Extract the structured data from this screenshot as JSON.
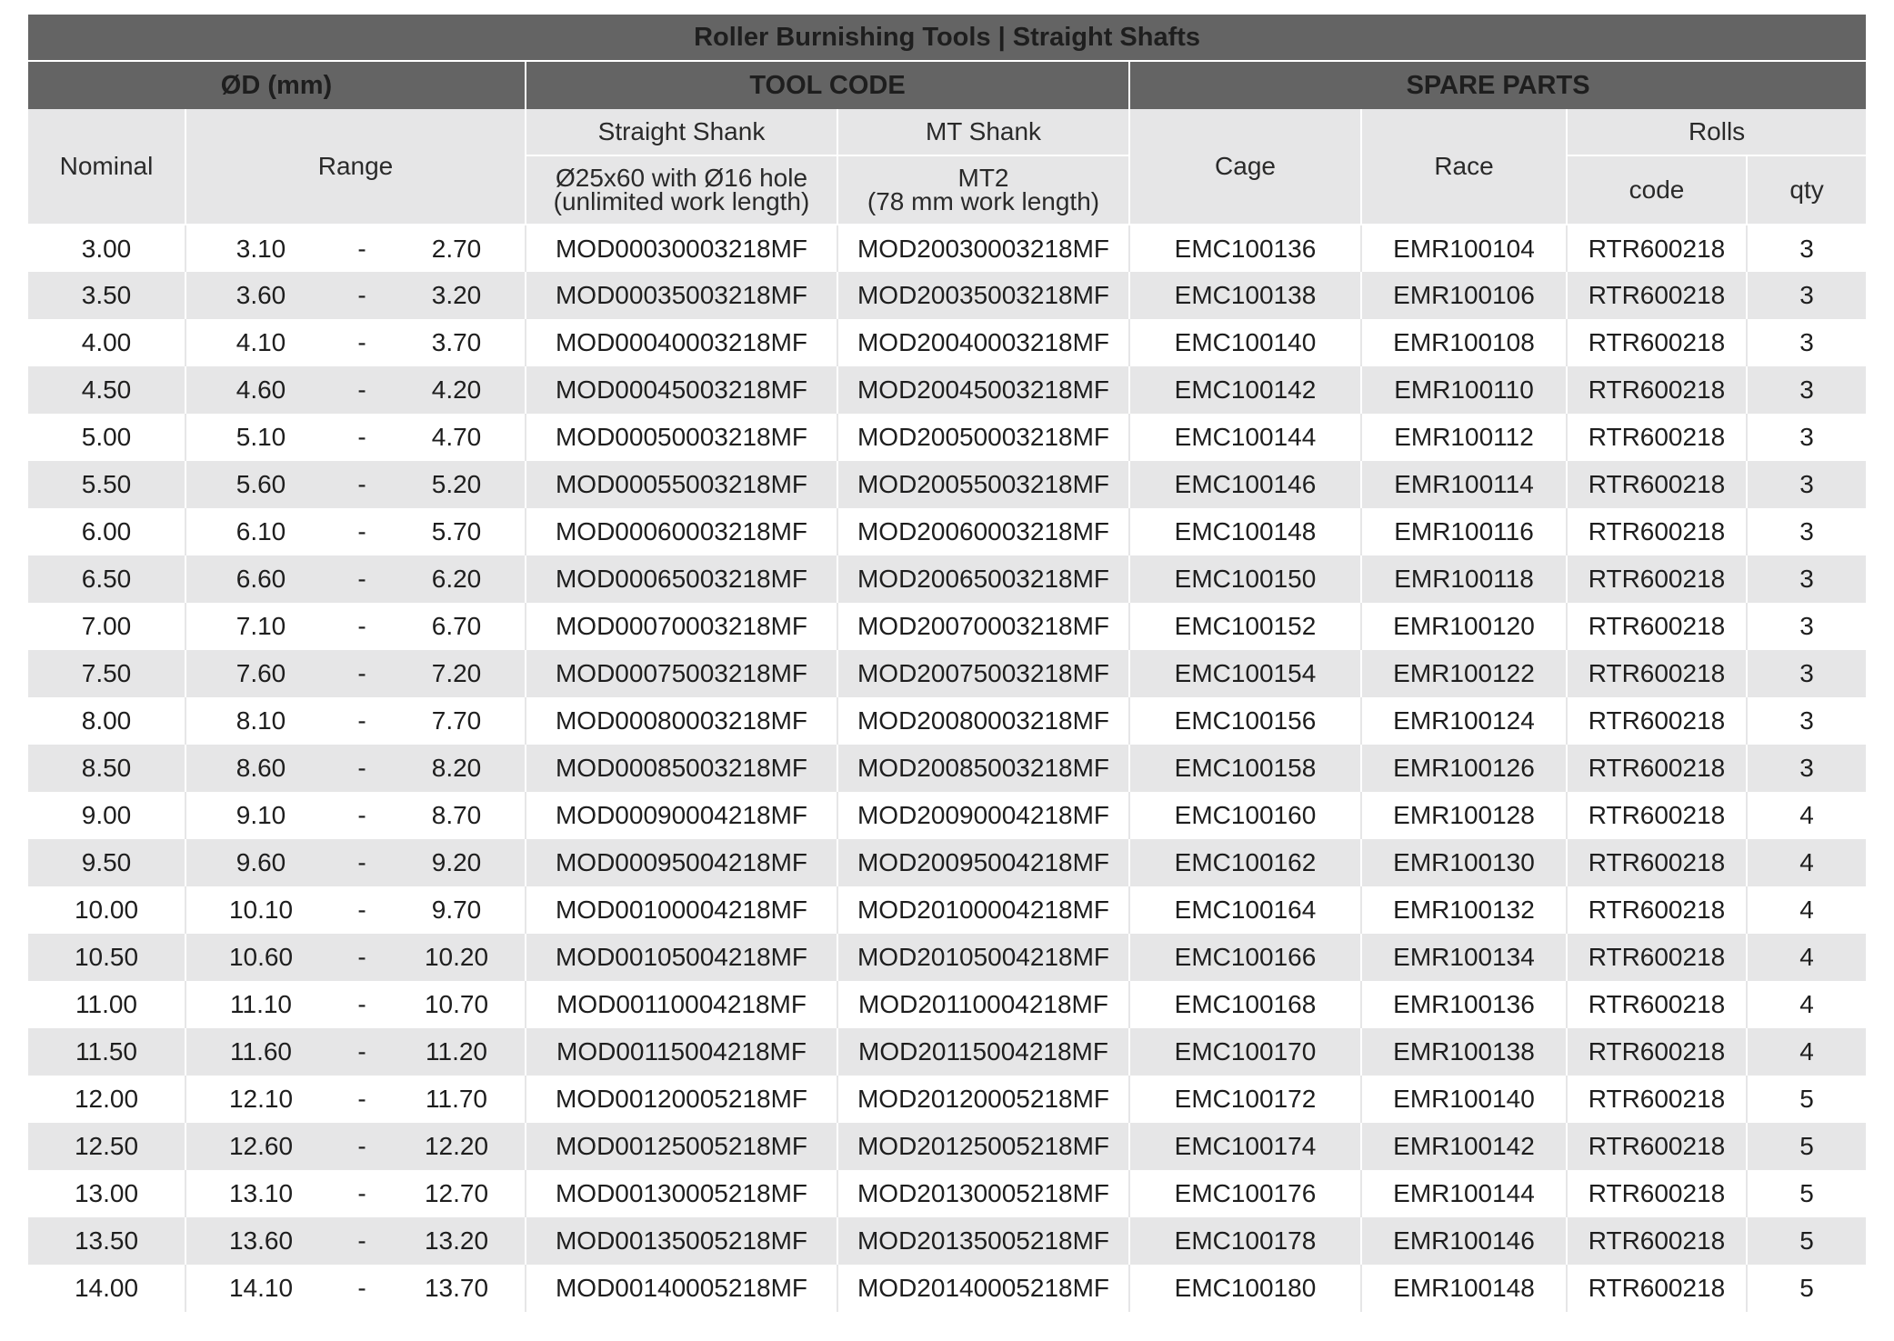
{
  "table": {
    "title": "Roller Burnishing Tools | Straight Shafts",
    "groups": {
      "od": "ØD (mm)",
      "tool_code": "TOOL CODE",
      "spare_parts": "SPARE PARTS"
    },
    "headers": {
      "nominal": "Nominal",
      "range": "Range",
      "straight_shank": "Straight Shank",
      "straight_shank_line1": "Ø25x60 with Ø16 hole",
      "straight_shank_line2": "(unlimited work length)",
      "mt_shank": "MT Shank",
      "mt_shank_line1": "MT2",
      "mt_shank_line2": "(78 mm work length)",
      "cage": "Cage",
      "race": "Race",
      "rolls": "Rolls",
      "rolls_code": "code",
      "rolls_qty": "qty"
    },
    "rows": [
      {
        "nominal": "3.00",
        "range_max": "3.10",
        "dash": "-",
        "range_min": "2.70",
        "straight_code": "MOD00030003218MF",
        "mt_code": "MOD20030003218MF",
        "cage": "EMC100136",
        "race": "EMR100104",
        "rolls_code": "RTR600218",
        "qty": "3"
      },
      {
        "nominal": "3.50",
        "range_max": "3.60",
        "dash": "-",
        "range_min": "3.20",
        "straight_code": "MOD00035003218MF",
        "mt_code": "MOD20035003218MF",
        "cage": "EMC100138",
        "race": "EMR100106",
        "rolls_code": "RTR600218",
        "qty": "3"
      },
      {
        "nominal": "4.00",
        "range_max": "4.10",
        "dash": "-",
        "range_min": "3.70",
        "straight_code": "MOD00040003218MF",
        "mt_code": "MOD20040003218MF",
        "cage": "EMC100140",
        "race": "EMR100108",
        "rolls_code": "RTR600218",
        "qty": "3"
      },
      {
        "nominal": "4.50",
        "range_max": "4.60",
        "dash": "-",
        "range_min": "4.20",
        "straight_code": "MOD00045003218MF",
        "mt_code": "MOD20045003218MF",
        "cage": "EMC100142",
        "race": "EMR100110",
        "rolls_code": "RTR600218",
        "qty": "3"
      },
      {
        "nominal": "5.00",
        "range_max": "5.10",
        "dash": "-",
        "range_min": "4.70",
        "straight_code": "MOD00050003218MF",
        "mt_code": "MOD20050003218MF",
        "cage": "EMC100144",
        "race": "EMR100112",
        "rolls_code": "RTR600218",
        "qty": "3"
      },
      {
        "nominal": "5.50",
        "range_max": "5.60",
        "dash": "-",
        "range_min": "5.20",
        "straight_code": "MOD00055003218MF",
        "mt_code": "MOD20055003218MF",
        "cage": "EMC100146",
        "race": "EMR100114",
        "rolls_code": "RTR600218",
        "qty": "3"
      },
      {
        "nominal": "6.00",
        "range_max": "6.10",
        "dash": "-",
        "range_min": "5.70",
        "straight_code": "MOD00060003218MF",
        "mt_code": "MOD20060003218MF",
        "cage": "EMC100148",
        "race": "EMR100116",
        "rolls_code": "RTR600218",
        "qty": "3"
      },
      {
        "nominal": "6.50",
        "range_max": "6.60",
        "dash": "-",
        "range_min": "6.20",
        "straight_code": "MOD00065003218MF",
        "mt_code": "MOD20065003218MF",
        "cage": "EMC100150",
        "race": "EMR100118",
        "rolls_code": "RTR600218",
        "qty": "3"
      },
      {
        "nominal": "7.00",
        "range_max": "7.10",
        "dash": "-",
        "range_min": "6.70",
        "straight_code": "MOD00070003218MF",
        "mt_code": "MOD20070003218MF",
        "cage": "EMC100152",
        "race": "EMR100120",
        "rolls_code": "RTR600218",
        "qty": "3"
      },
      {
        "nominal": "7.50",
        "range_max": "7.60",
        "dash": "-",
        "range_min": "7.20",
        "straight_code": "MOD00075003218MF",
        "mt_code": "MOD20075003218MF",
        "cage": "EMC100154",
        "race": "EMR100122",
        "rolls_code": "RTR600218",
        "qty": "3"
      },
      {
        "nominal": "8.00",
        "range_max": "8.10",
        "dash": "-",
        "range_min": "7.70",
        "straight_code": "MOD00080003218MF",
        "mt_code": "MOD20080003218MF",
        "cage": "EMC100156",
        "race": "EMR100124",
        "rolls_code": "RTR600218",
        "qty": "3"
      },
      {
        "nominal": "8.50",
        "range_max": "8.60",
        "dash": "-",
        "range_min": "8.20",
        "straight_code": "MOD00085003218MF",
        "mt_code": "MOD20085003218MF",
        "cage": "EMC100158",
        "race": "EMR100126",
        "rolls_code": "RTR600218",
        "qty": "3"
      },
      {
        "nominal": "9.00",
        "range_max": "9.10",
        "dash": "-",
        "range_min": "8.70",
        "straight_code": "MOD00090004218MF",
        "mt_code": "MOD20090004218MF",
        "cage": "EMC100160",
        "race": "EMR100128",
        "rolls_code": "RTR600218",
        "qty": "4"
      },
      {
        "nominal": "9.50",
        "range_max": "9.60",
        "dash": "-",
        "range_min": "9.20",
        "straight_code": "MOD00095004218MF",
        "mt_code": "MOD20095004218MF",
        "cage": "EMC100162",
        "race": "EMR100130",
        "rolls_code": "RTR600218",
        "qty": "4"
      },
      {
        "nominal": "10.00",
        "range_max": "10.10",
        "dash": "-",
        "range_min": "9.70",
        "straight_code": "MOD00100004218MF",
        "mt_code": "MOD20100004218MF",
        "cage": "EMC100164",
        "race": "EMR100132",
        "rolls_code": "RTR600218",
        "qty": "4"
      },
      {
        "nominal": "10.50",
        "range_max": "10.60",
        "dash": "-",
        "range_min": "10.20",
        "straight_code": "MOD00105004218MF",
        "mt_code": "MOD20105004218MF",
        "cage": "EMC100166",
        "race": "EMR100134",
        "rolls_code": "RTR600218",
        "qty": "4"
      },
      {
        "nominal": "11.00",
        "range_max": "11.10",
        "dash": "-",
        "range_min": "10.70",
        "straight_code": "MOD00110004218MF",
        "mt_code": "MOD20110004218MF",
        "cage": "EMC100168",
        "race": "EMR100136",
        "rolls_code": "RTR600218",
        "qty": "4"
      },
      {
        "nominal": "11.50",
        "range_max": "11.60",
        "dash": "-",
        "range_min": "11.20",
        "straight_code": "MOD00115004218MF",
        "mt_code": "MOD20115004218MF",
        "cage": "EMC100170",
        "race": "EMR100138",
        "rolls_code": "RTR600218",
        "qty": "4"
      },
      {
        "nominal": "12.00",
        "range_max": "12.10",
        "dash": "-",
        "range_min": "11.70",
        "straight_code": "MOD00120005218MF",
        "mt_code": "MOD20120005218MF",
        "cage": "EMC100172",
        "race": "EMR100140",
        "rolls_code": "RTR600218",
        "qty": "5"
      },
      {
        "nominal": "12.50",
        "range_max": "12.60",
        "dash": "-",
        "range_min": "12.20",
        "straight_code": "MOD00125005218MF",
        "mt_code": "MOD20125005218MF",
        "cage": "EMC100174",
        "race": "EMR100142",
        "rolls_code": "RTR600218",
        "qty": "5"
      },
      {
        "nominal": "13.00",
        "range_max": "13.10",
        "dash": "-",
        "range_min": "12.70",
        "straight_code": "MOD00130005218MF",
        "mt_code": "MOD20130005218MF",
        "cage": "EMC100176",
        "race": "EMR100144",
        "rolls_code": "RTR600218",
        "qty": "5"
      },
      {
        "nominal": "13.50",
        "range_max": "13.60",
        "dash": "-",
        "range_min": "13.20",
        "straight_code": "MOD00135005218MF",
        "mt_code": "MOD20135005218MF",
        "cage": "EMC100178",
        "race": "EMR100146",
        "rolls_code": "RTR600218",
        "qty": "5"
      },
      {
        "nominal": "14.00",
        "range_max": "14.10",
        "dash": "-",
        "range_min": "13.70",
        "straight_code": "MOD00140005218MF",
        "mt_code": "MOD20140005218MF",
        "cage": "EMC100180",
        "race": "EMR100148",
        "rolls_code": "RTR600218",
        "qty": "5"
      }
    ]
  },
  "colors": {
    "header_dark": "#646464",
    "row_alt": "#e6e6e7",
    "row_base": "#ffffff",
    "text": "#1e1e1e"
  }
}
